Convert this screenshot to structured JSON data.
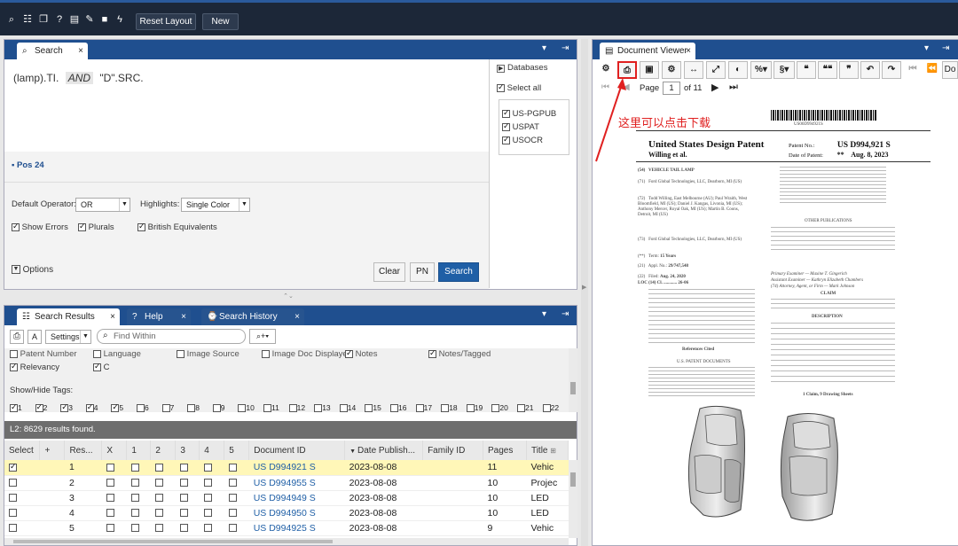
{
  "toolbar": {
    "reset_label": "Reset Layout",
    "new_label": "New"
  },
  "search_panel": {
    "tab": "Search",
    "query": {
      "part1": "(lamp).TI.",
      "op": "AND",
      "part2": "\"D\".SRC."
    },
    "pos": "Pos 24",
    "databases_label": "Databases",
    "select_all": "Select all",
    "dbs": [
      "US-PGPUB",
      "USPAT",
      "USOCR"
    ],
    "default_operator_label": "Default Operator:",
    "default_operator": "OR",
    "highlights_label": "Highlights:",
    "highlights": "Single Color",
    "show_errors": "Show Errors",
    "plurals": "Plurals",
    "british": "British Equivalents",
    "options": "Options",
    "clear": "Clear",
    "pn": "PN",
    "search": "Search"
  },
  "results_panel": {
    "tabs": [
      "Search Results",
      "Help",
      "Search History"
    ],
    "settings": "Settings",
    "find_placeholder": "Find Within",
    "fields": [
      "Patent Number",
      "Language",
      "Image Source",
      "Image Doc Displayed",
      "Notes",
      "Notes/Tagged",
      "Relevancy",
      "C"
    ],
    "showhide": "Show/Hide Tags:",
    "tags": [
      "1",
      "2",
      "3",
      "4",
      "5",
      "6",
      "7",
      "8",
      "9",
      "10",
      "11",
      "12",
      "13",
      "14",
      "15",
      "16",
      "17",
      "18",
      "19",
      "20",
      "21",
      "22"
    ],
    "status": "L2: 8629 results found.",
    "columns": [
      "Select",
      "+",
      "Res...",
      "X",
      "1",
      "2",
      "3",
      "4",
      "5",
      "Document ID",
      "Date Publish...",
      "Family ID",
      "Pages",
      "Title"
    ],
    "rows": [
      {
        "res": "1",
        "doc": "US D994921 S",
        "date": "2023-08-08",
        "pages": "11",
        "title": "Vehic"
      },
      {
        "res": "2",
        "doc": "US D994955 S",
        "date": "2023-08-08",
        "pages": "10",
        "title": "Projec"
      },
      {
        "res": "3",
        "doc": "US D994949 S",
        "date": "2023-08-08",
        "pages": "10",
        "title": "LED"
      },
      {
        "res": "4",
        "doc": "US D994950 S",
        "date": "2023-08-08",
        "pages": "10",
        "title": "LED"
      },
      {
        "res": "5",
        "doc": "US D994925 S",
        "date": "2023-08-08",
        "pages": "9",
        "title": "Vehic"
      }
    ]
  },
  "viewer": {
    "tab": "Document Viewer",
    "page_label": "Page",
    "page": "1",
    "of": "of 11",
    "annotation": "这里可以点击下载",
    "doc": {
      "barcode_text": "US00D994921S",
      "header": "United States Design Patent",
      "inventor": "Willing et al.",
      "patent_no_label": "Patent No.:",
      "patent_no": "US D994,921 S",
      "date_label": "Date of Patent:",
      "date_prefix": "**",
      "date": "Aug. 8, 2023",
      "title": "VEHICLE TAIL LAMP",
      "applicant": "Ford Global Technologies, LLC, Dearborn, MI (US)",
      "inventors": "Todd Willing, East Melbourne (AU); Paul Wraith, West Bloomfield, MI (US); Daniel J. Kangas, Livonia, MI (US); Anthony Mercer, Royal Oak, MI (US); Martin B. Coons, Detroit, MI (US)",
      "assignee": "Ford Global Technologies, LLC, Dearborn, MI (US)",
      "term": "15 Years",
      "appl_no": "29/747,548",
      "filed": "Aug. 24, 2020",
      "loc": "LOC (14) Cl. ............ 26-06",
      "other_pubs": "OTHER PUBLICATIONS",
      "claim": "CLAIM",
      "description": "DESCRIPTION",
      "refs": "References Cited",
      "us_docs": "U.S. PATENT DOCUMENTS",
      "claims_drawings": "1 Claim, 9 Drawing Sheets",
      "primary_examiner": "Primary Examiner — Maxine T. Gingerich",
      "assistant_examiner": "Assistant Examiner — Kathryn Elizabeth Chambers",
      "attorney": "(74) Attorney, Agent, or Firm — Mark Johnson"
    }
  },
  "colors": {
    "accent": "#1f4f8f",
    "highlight_row": "#fff7b8",
    "annotation": "#e02020"
  }
}
